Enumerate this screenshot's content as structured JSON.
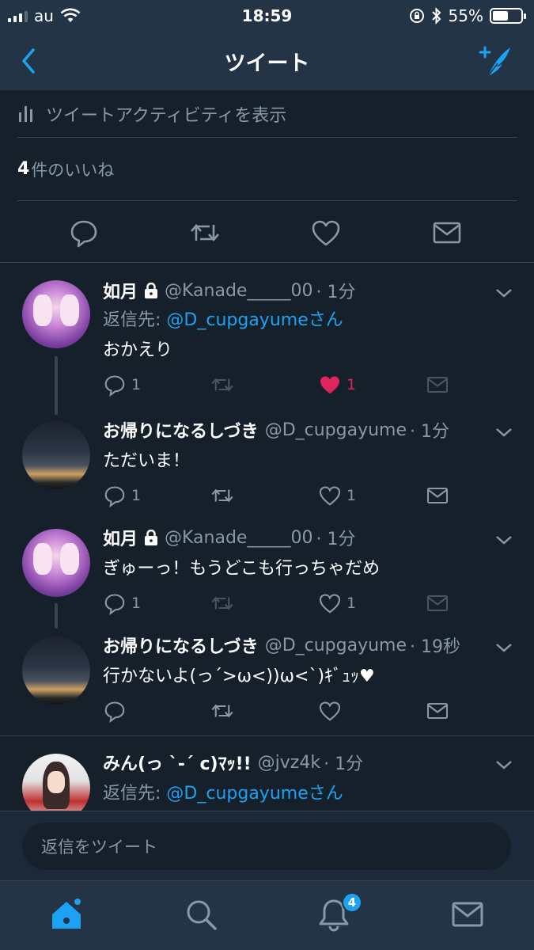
{
  "status_bar": {
    "carrier": "au",
    "time": "18:59",
    "battery": "55%",
    "battery_level": 0.55
  },
  "nav": {
    "title": "ツイート"
  },
  "tweet_detail": {
    "activity_label": "ツイートアクティビティを表示",
    "likes_count": "4",
    "likes_label": "件のいいね"
  },
  "replies": [
    {
      "name": "如月",
      "protected": true,
      "handle": "@Kanade_____00",
      "time": "· 1分",
      "reply_to_prefix": "返信先: ",
      "reply_to_handle": "@D_cupgayumeさん",
      "text": "おかえり",
      "reply_count": "1",
      "retweet_count": "",
      "like_count": "1",
      "liked": true
    },
    {
      "name": "お帰りになるしづき",
      "protected": false,
      "handle": "@D_cupgayume",
      "time": "· 1分",
      "text": "ただいま！",
      "reply_count": "1",
      "retweet_count": "",
      "like_count": "1",
      "liked": false
    },
    {
      "name": "如月",
      "protected": true,
      "handle": "@Kanade_____00",
      "time": "· 1分",
      "text": "ぎゅーっ！もうどこも行っちゃだめ",
      "reply_count": "1",
      "retweet_count": "",
      "like_count": "1",
      "liked": false
    },
    {
      "name": "お帰りになるしづき",
      "protected": false,
      "handle": "@D_cupgayume",
      "time": "· 19秒",
      "text": "行かないよ(っ´>ω<))ω<`)ｷﾞｭｯ♥",
      "reply_count": "",
      "retweet_count": "",
      "like_count": "",
      "liked": false
    },
    {
      "name": "みん(っ `-´ c)ﾏｯ!!",
      "protected": false,
      "handle": "@jvz4k",
      "time": "· 1分",
      "reply_to_prefix": "返信先: ",
      "reply_to_handle": "@D_cupgayumeさん"
    }
  ],
  "composer": {
    "placeholder": "返信をツイート"
  },
  "tabbar": {
    "notification_badge": "4",
    "icons": [
      "home-icon",
      "search-icon",
      "bell-icon",
      "mail-icon"
    ]
  },
  "colors": {
    "background": "#15202b",
    "bar": "#243447",
    "accent": "#1da1f2",
    "like": "#e0245e",
    "muted": "#8899a6"
  }
}
